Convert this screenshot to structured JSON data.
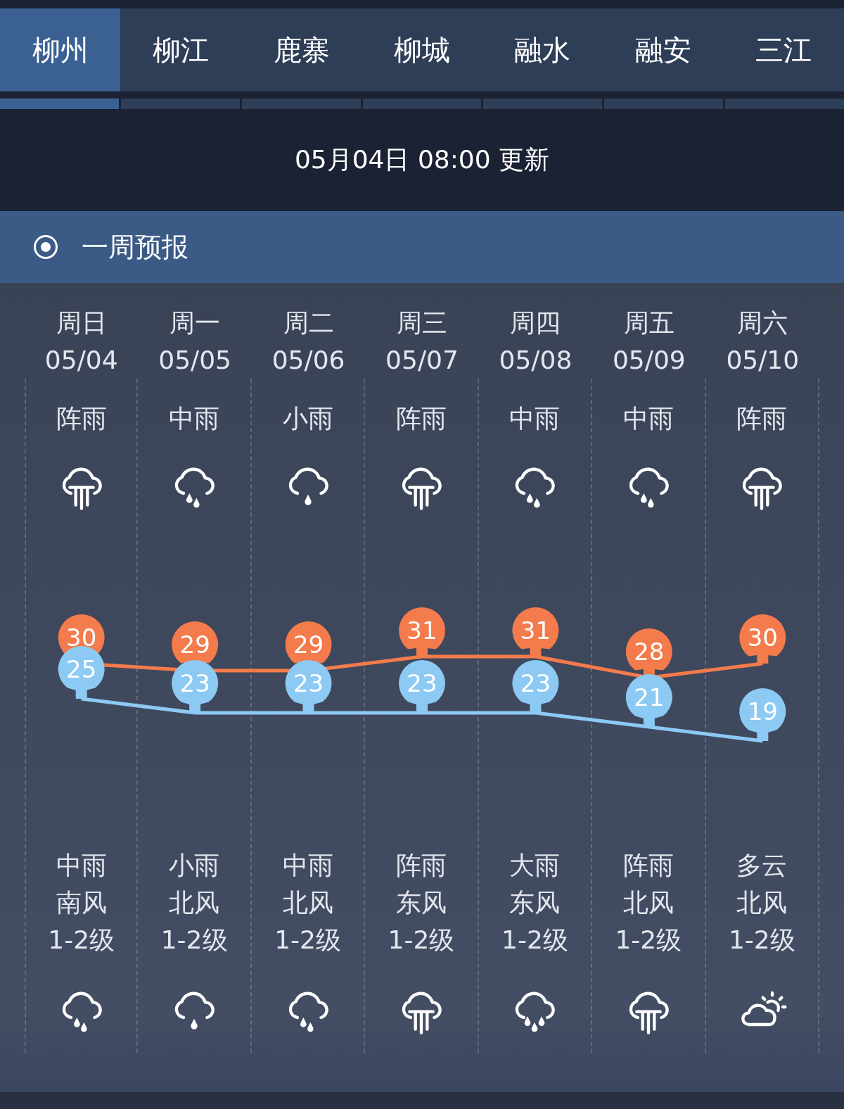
{
  "tabs": [
    {
      "label": "柳州",
      "selected": true
    },
    {
      "label": "柳江",
      "selected": false
    },
    {
      "label": "鹿寨",
      "selected": false
    },
    {
      "label": "柳城",
      "selected": false
    },
    {
      "label": "融水",
      "selected": false
    },
    {
      "label": "融安",
      "selected": false
    },
    {
      "label": "三江",
      "selected": false
    }
  ],
  "update_time": "05月04日 08:00 更新",
  "section": {
    "title": "一周预报",
    "selected": true
  },
  "days": [
    {
      "weekday": "周日",
      "date": "05/04",
      "day": {
        "weather": "阵雨",
        "kind": "shower"
      },
      "high": "30",
      "low": "25",
      "night": {
        "weather": "中雨",
        "kind": "rain2",
        "wind": "南风",
        "level": "1-2级"
      }
    },
    {
      "weekday": "周一",
      "date": "05/05",
      "day": {
        "weather": "中雨",
        "kind": "rain2"
      },
      "high": "29",
      "low": "23",
      "night": {
        "weather": "小雨",
        "kind": "rain1",
        "wind": "北风",
        "level": "1-2级"
      }
    },
    {
      "weekday": "周二",
      "date": "05/06",
      "day": {
        "weather": "小雨",
        "kind": "rain1"
      },
      "high": "29",
      "low": "23",
      "night": {
        "weather": "中雨",
        "kind": "rain2",
        "wind": "北风",
        "level": "1-2级"
      }
    },
    {
      "weekday": "周三",
      "date": "05/07",
      "day": {
        "weather": "阵雨",
        "kind": "shower"
      },
      "high": "31",
      "low": "23",
      "night": {
        "weather": "阵雨",
        "kind": "shower",
        "wind": "东风",
        "level": "1-2级"
      }
    },
    {
      "weekday": "周四",
      "date": "05/08",
      "day": {
        "weather": "中雨",
        "kind": "rain2"
      },
      "high": "31",
      "low": "23",
      "night": {
        "weather": "大雨",
        "kind": "rain3",
        "wind": "东风",
        "level": "1-2级"
      }
    },
    {
      "weekday": "周五",
      "date": "05/09",
      "day": {
        "weather": "中雨",
        "kind": "rain2"
      },
      "high": "28",
      "low": "21",
      "night": {
        "weather": "阵雨",
        "kind": "shower",
        "wind": "北风",
        "level": "1-2级"
      }
    },
    {
      "weekday": "周六",
      "date": "05/10",
      "day": {
        "weather": "阵雨",
        "kind": "shower"
      },
      "high": "30",
      "low": "19",
      "night": {
        "weather": "多云",
        "kind": "partly",
        "wind": "北风",
        "level": "1-2级"
      }
    }
  ]
}
